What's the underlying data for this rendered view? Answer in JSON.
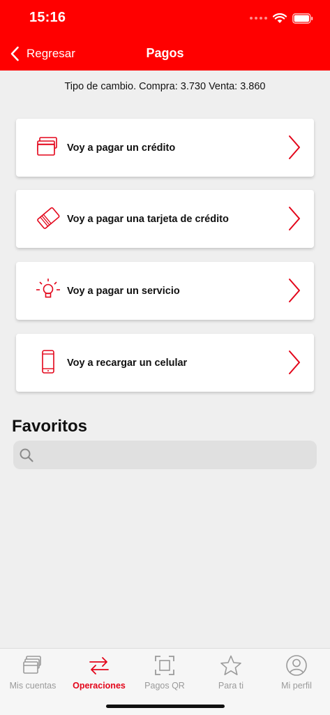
{
  "status_bar": {
    "time": "15:16"
  },
  "nav": {
    "back_label": "Regresar",
    "title": "Pagos"
  },
  "exchange_rate": "Tipo de cambio. Compra: 3.730 Venta: 3.860",
  "options": [
    {
      "label": "Voy a pagar un crédito",
      "icon": "cards-stack-icon"
    },
    {
      "label": "Voy a pagar una tarjeta de crédito",
      "icon": "credit-card-icon"
    },
    {
      "label": "Voy a pagar un servicio",
      "icon": "light-bulb-icon"
    },
    {
      "label": "Voy a recargar un celular",
      "icon": "mobile-phone-icon"
    }
  ],
  "favorites": {
    "title": "Favoritos",
    "search_placeholder": "",
    "search_value": ""
  },
  "tabs": [
    {
      "label": "Mis cuentas",
      "icon": "wallet-icon",
      "active": false
    },
    {
      "label": "Operaciones",
      "icon": "transfer-arrows-icon",
      "active": true
    },
    {
      "label": "Pagos QR",
      "icon": "qr-scan-icon",
      "active": false
    },
    {
      "label": "Para ti",
      "icon": "star-icon",
      "active": false
    },
    {
      "label": "Mi perfil",
      "icon": "profile-icon",
      "active": false
    }
  ],
  "colors": {
    "brand_red": "#ff0000",
    "accent_red": "#e3051a",
    "background": "#efefef",
    "inactive_gray": "#9a9a9a"
  }
}
